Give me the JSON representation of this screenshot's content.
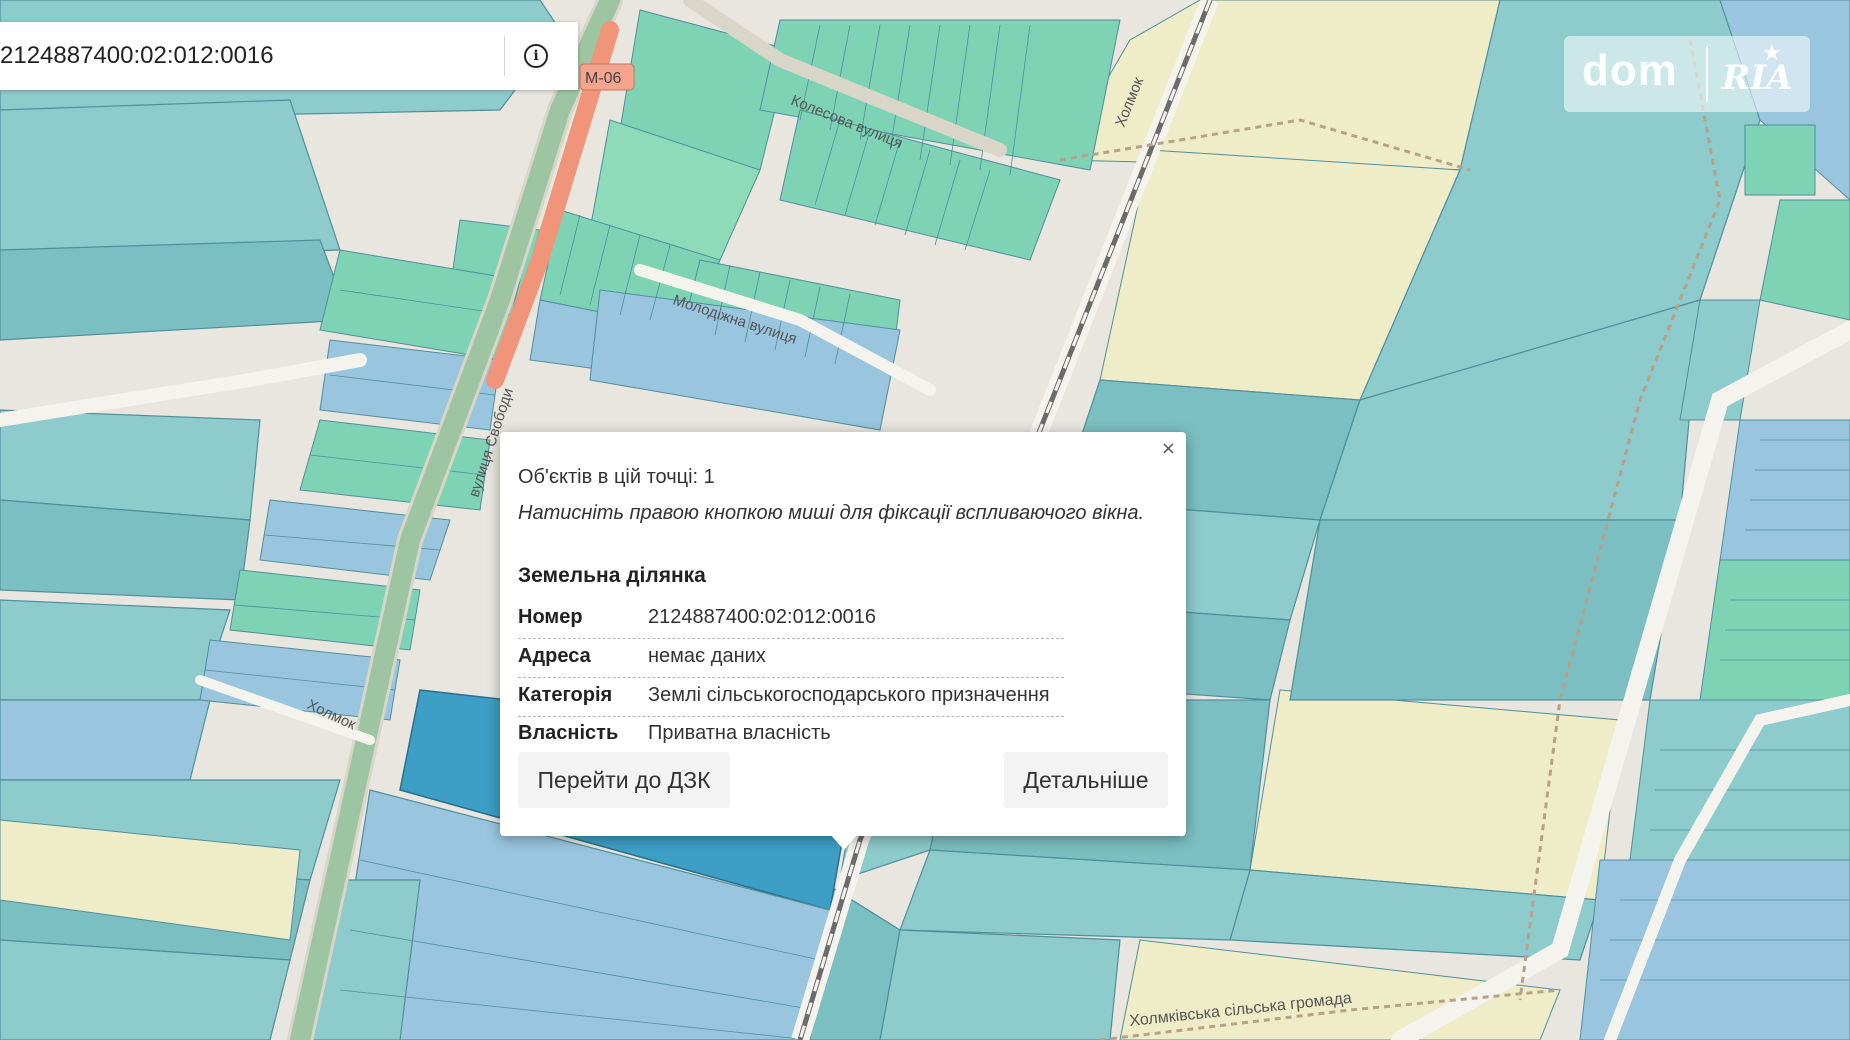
{
  "search": {
    "value": "2124887400:02:012:0016"
  },
  "logo": {
    "dom": "dom",
    "ria": "RIA"
  },
  "map": {
    "colors": {
      "background": "#e8e6df",
      "parcel": "#8ecbcc",
      "parcel_dark": "#7cbfc2",
      "parcel_border": "#4f8f9c",
      "parcel_green": "#7ed3b4",
      "parcel_blue": "#99c6de",
      "parcel_selected": "#3d9fc6",
      "field": "#efedc8",
      "highway": "#f0957a",
      "rail": "#6b6b6b",
      "boundary": "#b8a089"
    },
    "labels": {
      "highway_ref": "М-06",
      "street_1": "Колесова вулиця",
      "street_2": "Молодіжна вулиця",
      "street_3": "вулиця Свободи",
      "place_1": "Холмок",
      "place_2": "Холмок",
      "community": "Холмківська сільська громада"
    }
  },
  "popup": {
    "close_icon": "×",
    "count": "Об'єктів в цій точці: 1",
    "hint": "Натисніть правою кнопкою миші для фіксації вспливаючого вікна.",
    "heading": "Земельна ділянка",
    "rows": [
      {
        "key": "Номер",
        "value": "2124887400:02:012:0016"
      },
      {
        "key": "Адреса",
        "value": "немає даних"
      },
      {
        "key": "Категорія",
        "value": "Землі сільськогосподарського призначення"
      },
      {
        "key": "Власність",
        "value": "Приватна власність"
      }
    ],
    "btn_dzk": "Перейти до ДЗК",
    "btn_detail": "Детальніше"
  }
}
